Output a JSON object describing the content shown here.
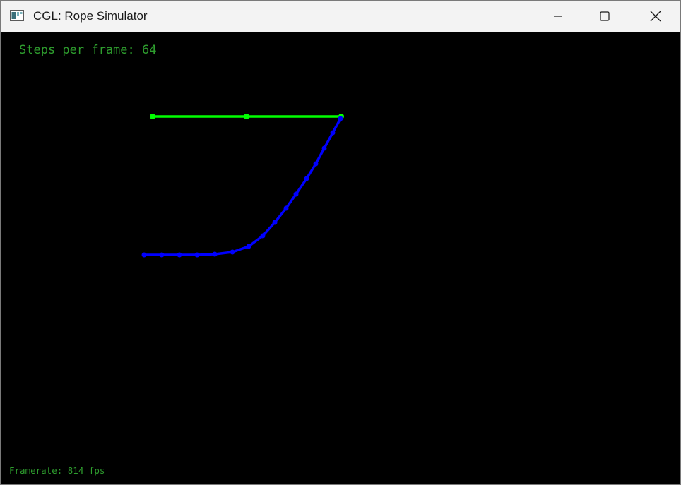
{
  "window": {
    "title": "CGL: Rope Simulator",
    "icons": {
      "app": "app-window-icon",
      "minimize": "minimize-icon",
      "maximize": "maximize-icon",
      "close": "close-icon"
    }
  },
  "hud": {
    "steps_per_frame": "Steps per frame: 64",
    "framerate": "Framerate: 814 fps"
  },
  "colors": {
    "background": "#000000",
    "hud_text": "#2e9e2e",
    "rope_green": "#00ff00",
    "rope_blue": "#0000ff"
  }
}
